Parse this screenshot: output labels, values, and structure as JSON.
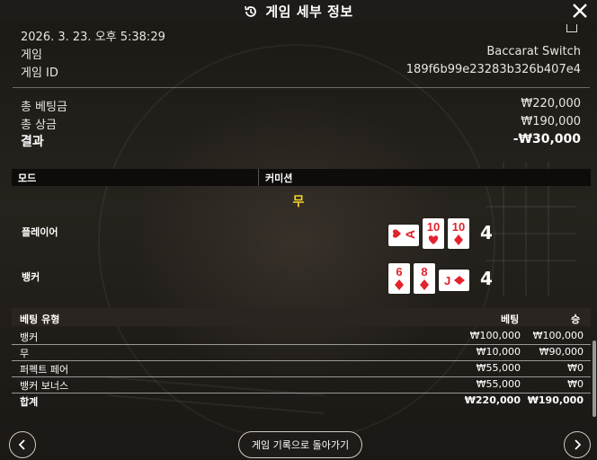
{
  "header": {
    "title": "게임 세부 정보"
  },
  "info": {
    "datetime": "2026. 3. 23. 오후 5:38:29",
    "game_label": "게임",
    "game_value": "Baccarat Switch",
    "game_id_label": "게임 ID",
    "game_id_value": "189f6b99e23283b326b407e4"
  },
  "summary": {
    "total_bet_label": "총 베팅금",
    "total_bet_value": "₩220,000",
    "total_win_label": "총 상금",
    "total_win_value": "₩190,000",
    "result_label": "결과",
    "result_value": "-₩30,000"
  },
  "mode": {
    "mode_label": "모드",
    "commission_label": "커미션"
  },
  "outcome": {
    "result_word": "무",
    "result_color": "#f3d12a",
    "player": {
      "label": "플레이어",
      "score": "4",
      "cards": [
        {
          "rank": "A",
          "suit": "heart",
          "rotated": true
        },
        {
          "rank": "10",
          "suit": "heart",
          "rotated": false
        },
        {
          "rank": "10",
          "suit": "diamond",
          "rotated": false
        }
      ]
    },
    "banker": {
      "label": "뱅커",
      "score": "4",
      "cards": [
        {
          "rank": "6",
          "suit": "diamond",
          "rotated": false
        },
        {
          "rank": "8",
          "suit": "diamond",
          "rotated": false
        },
        {
          "rank": "J",
          "suit": "diamond",
          "rotated": true
        }
      ]
    }
  },
  "bets_table": {
    "headers": {
      "type": "베팅 유형",
      "bet": "베팅",
      "win": "승"
    },
    "rows": [
      {
        "type": "뱅커",
        "bet": "₩100,000",
        "win": "₩100,000"
      },
      {
        "type": "무",
        "bet": "₩10,000",
        "win": "₩90,000"
      },
      {
        "type": "퍼펙트 페어",
        "bet": "₩55,000",
        "win": "₩0"
      },
      {
        "type": "뱅커 보너스",
        "bet": "₩55,000",
        "win": "₩0"
      }
    ],
    "total": {
      "type": "합계",
      "bet": "₩220,000",
      "win": "₩190,000"
    }
  },
  "footer": {
    "back_label": "게임 기록으로 돌아가기"
  },
  "colors": {
    "red_suit": "#e1232d",
    "accent_yellow": "#f3d12a"
  },
  "icons": {
    "history": "history-icon",
    "close": "close-icon",
    "prev": "chevron-left-icon",
    "next": "chevron-right-icon"
  }
}
